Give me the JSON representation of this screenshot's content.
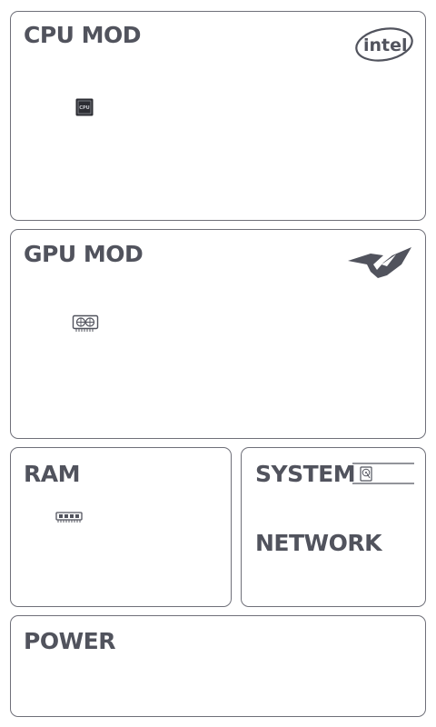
{
  "cpu": {
    "title": "CPU MOD",
    "brand_logo": "intel-logo",
    "icon": "cpu-chip-icon",
    "icon_label": "CPU"
  },
  "gpu": {
    "title": "GPU MOD",
    "brand_logo": "rog-logo",
    "icon": "gpu-card-icon"
  },
  "ram": {
    "title": "RAM",
    "icon": "ram-stick-icon"
  },
  "system": {
    "title": "SYSTEM",
    "icon": "hdd-icon",
    "network_title": "NETWORK"
  },
  "power": {
    "title": "POWER"
  },
  "colors": {
    "border": "#6f7079",
    "text": "#51535d",
    "background": "#ffffff"
  }
}
